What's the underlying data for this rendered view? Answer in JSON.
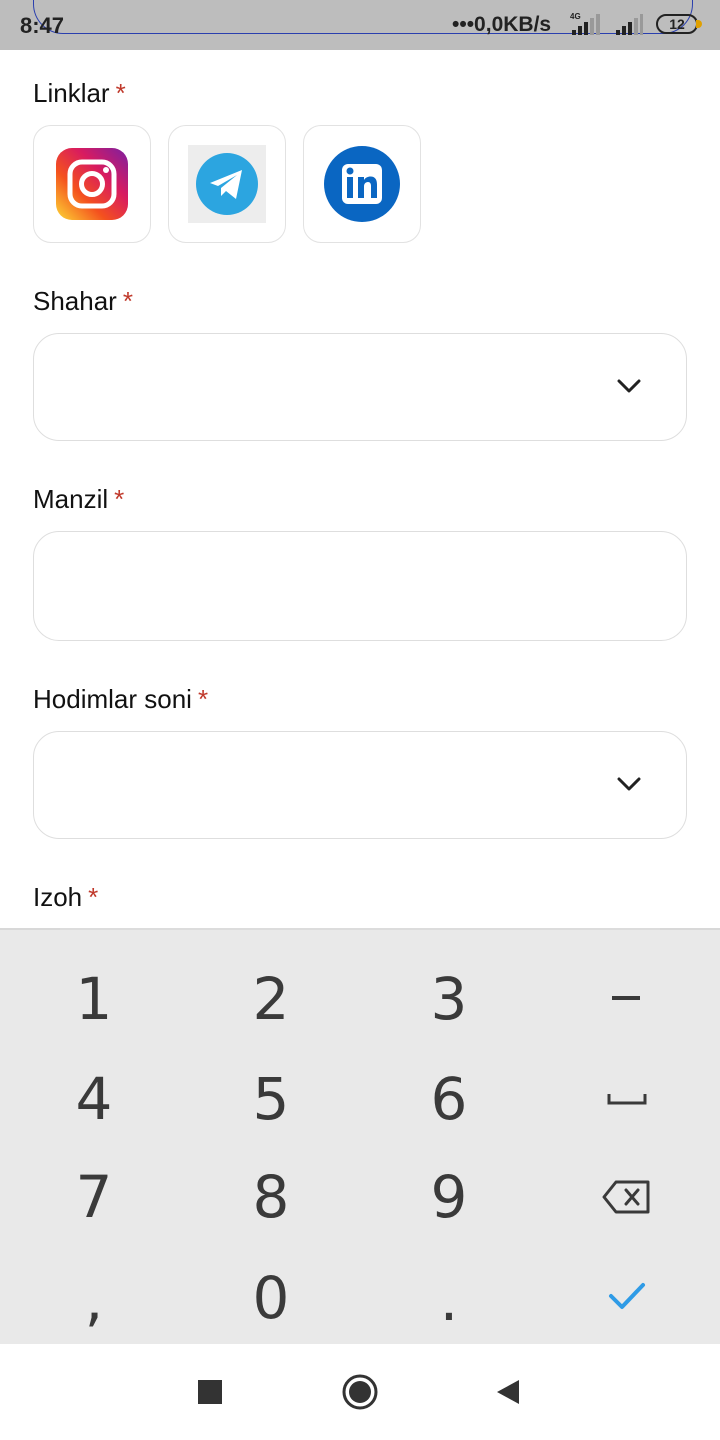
{
  "status_bar": {
    "time": "8:47",
    "network_speed": "•••0,0KB/s",
    "network_type": "4G",
    "battery": "12"
  },
  "form": {
    "links": {
      "label": "Linklar",
      "required_mark": "*"
    },
    "social_icons": [
      "instagram-icon",
      "telegram-icon",
      "linkedin-icon"
    ],
    "city": {
      "label": "Shahar",
      "required_mark": "*",
      "value": ""
    },
    "address": {
      "label": "Manzil",
      "required_mark": "*",
      "value": ""
    },
    "employees": {
      "label": "Hodimlar soni",
      "required_mark": "*",
      "value": ""
    },
    "comment": {
      "label": "Izoh",
      "required_mark": "*"
    }
  },
  "keyboard": {
    "keys": [
      "1",
      "2",
      "3",
      "–",
      "4",
      "5",
      "6",
      "␣",
      "7",
      "8",
      "9",
      "⌫",
      ",",
      "0",
      ".",
      "✓"
    ]
  },
  "colors": {
    "required": "#c0392b",
    "accent_check": "#2f9be6",
    "status_bar_bg": "#bdbdbd",
    "keyboard_bg": "#e9e9e9"
  }
}
